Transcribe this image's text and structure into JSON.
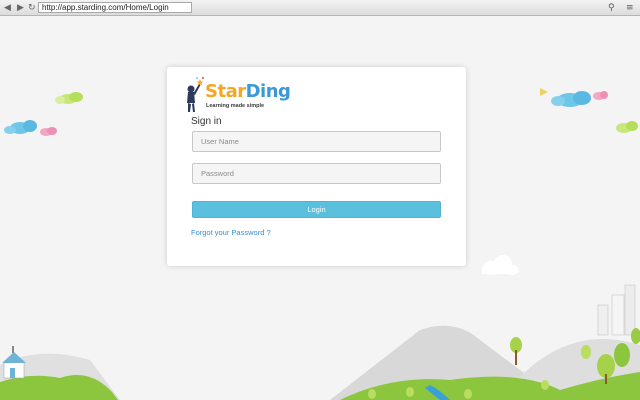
{
  "browser": {
    "back_glyph": "◀",
    "forward_glyph": "▶",
    "reload_glyph": "↻",
    "url": "http://app.starding.com/Home/Login",
    "search_glyph": "⚲",
    "menu_glyph": "≡"
  },
  "logo": {
    "name_part1": "Star",
    "name_part2": "Ding",
    "tagline": "Learning made simple"
  },
  "login": {
    "title": "Sign in",
    "username_placeholder": "User Name",
    "password_placeholder": "Password",
    "submit_label": "Login",
    "forgot_link": "Forgot your Password ?"
  },
  "colors": {
    "button": "#5bc0de",
    "link": "#3a8fd0",
    "grass": "#8cc63f",
    "cloud": "#6ec6e8"
  }
}
